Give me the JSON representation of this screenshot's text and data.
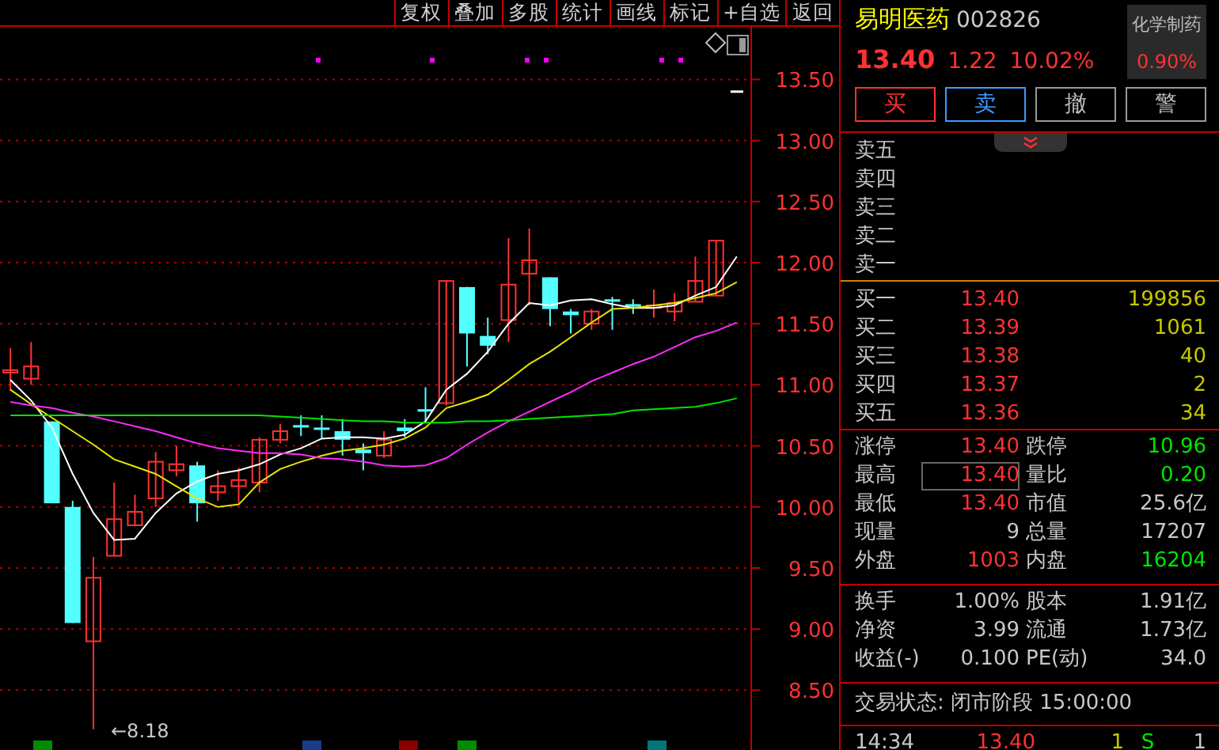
{
  "toolbar": [
    {
      "label": "复权"
    },
    {
      "label": "叠加"
    },
    {
      "label": "多股"
    },
    {
      "label": "统计"
    },
    {
      "label": "画线"
    },
    {
      "label": "标记"
    },
    {
      "label": "+自选"
    },
    {
      "label": "返回"
    }
  ],
  "chart": {
    "low_marker": "←8.18",
    "chart_data": {
      "type": "candlestick",
      "grid": true,
      "ylim": [
        8.01,
        13.93
      ],
      "yticks": [
        {
          "value": 13.5,
          "label": "13.50"
        },
        {
          "value": 13,
          "label": "13.00"
        },
        {
          "value": 12.5,
          "label": "12.50"
        },
        {
          "value": 12,
          "label": "12.00"
        },
        {
          "value": 11.5,
          "label": "11.50"
        },
        {
          "value": 11,
          "label": "11.00"
        },
        {
          "value": 10.5,
          "label": "10.50"
        },
        {
          "value": 10,
          "label": "10.00"
        },
        {
          "value": 9.5,
          "label": "9.50"
        },
        {
          "value": 9,
          "label": "9.00"
        },
        {
          "value": 8.5,
          "label": "8.50"
        }
      ],
      "categories": [
        null,
        null,
        null,
        null,
        null,
        null,
        null,
        null,
        null,
        null,
        null,
        null,
        null,
        null,
        null,
        null,
        null,
        null,
        null,
        null,
        null,
        null,
        null,
        null,
        null,
        null,
        null,
        null,
        null,
        null,
        null,
        null,
        null,
        null,
        null,
        null
      ],
      "ohlc": [
        [
          11.1,
          11.3,
          10.95,
          11.12
        ],
        [
          11.05,
          11.35,
          11.0,
          11.15
        ],
        [
          10.7,
          10.7,
          10.03,
          10.03
        ],
        [
          10.0,
          10.05,
          9.05,
          9.05
        ],
        [
          8.9,
          9.59,
          8.18,
          9.42
        ],
        [
          9.6,
          10.2,
          9.6,
          9.9
        ],
        [
          9.85,
          10.1,
          9.85,
          9.96
        ],
        [
          10.07,
          10.45,
          10.0,
          10.37
        ],
        [
          10.3,
          10.5,
          10.25,
          10.35
        ],
        [
          10.34,
          10.37,
          9.88,
          10.03
        ],
        [
          10.12,
          10.3,
          10.05,
          10.17
        ],
        [
          10.17,
          10.32,
          10.03,
          10.22
        ],
        [
          10.2,
          10.57,
          10.12,
          10.55
        ],
        [
          10.55,
          10.68,
          10.52,
          10.62
        ],
        [
          10.67,
          10.75,
          10.58,
          10.65
        ],
        [
          10.65,
          10.75,
          10.56,
          10.64
        ],
        [
          10.62,
          10.72,
          10.42,
          10.55
        ],
        [
          10.47,
          10.52,
          10.3,
          10.44
        ],
        [
          10.42,
          10.62,
          10.4,
          10.55
        ],
        [
          10.65,
          10.72,
          10.57,
          10.62
        ],
        [
          10.8,
          10.98,
          10.7,
          10.78
        ],
        [
          10.85,
          11.85,
          10.83,
          11.85
        ],
        [
          11.8,
          11.8,
          11.15,
          11.42
        ],
        [
          11.4,
          11.55,
          11.25,
          11.32
        ],
        [
          11.53,
          12.2,
          11.35,
          11.82
        ],
        [
          11.91,
          12.28,
          11.65,
          12.02
        ],
        [
          11.88,
          11.88,
          11.48,
          11.62
        ],
        [
          11.6,
          11.62,
          11.42,
          11.57
        ],
        [
          11.5,
          11.62,
          11.45,
          11.6
        ],
        [
          11.7,
          11.72,
          11.45,
          11.68
        ],
        [
          11.66,
          11.7,
          11.58,
          11.64
        ],
        [
          11.63,
          11.78,
          11.55,
          11.65
        ],
        [
          11.6,
          11.75,
          11.52,
          11.67
        ],
        [
          11.68,
          12.05,
          11.68,
          11.85
        ],
        [
          11.73,
          12.18,
          11.73,
          12.18
        ],
        [
          13.4,
          13.4,
          13.4,
          13.4
        ]
      ],
      "series": [
        {
          "type": "line",
          "color": "#ffffff",
          "values": [
            11.04,
            10.87,
            10.65,
            10.27,
            9.95,
            9.73,
            9.74,
            9.95,
            10.11,
            10.21,
            10.27,
            10.3,
            10.35,
            10.43,
            10.48,
            10.56,
            10.57,
            10.57,
            10.56,
            10.59,
            10.7,
            10.96,
            11.09,
            11.27,
            11.5,
            11.67,
            11.65,
            11.69,
            11.7,
            11.66,
            11.63,
            11.63,
            11.65,
            11.73,
            11.8,
            12.05
          ]
        },
        {
          "type": "line",
          "color": "#e6e600",
          "values": [
            10.96,
            10.84,
            10.73,
            10.62,
            10.51,
            10.39,
            10.33,
            10.27,
            10.17,
            10.07,
            10.0,
            10.02,
            10.2,
            10.31,
            10.37,
            10.42,
            10.46,
            10.48,
            10.51,
            10.56,
            10.65,
            10.81,
            10.86,
            10.92,
            11.04,
            11.17,
            11.27,
            11.39,
            11.51,
            11.62,
            11.63,
            11.65,
            11.67,
            11.71,
            11.75,
            11.84
          ]
        },
        {
          "type": "line",
          "color": "#ff2bff",
          "values": [
            10.86,
            10.83,
            10.81,
            10.77,
            10.74,
            10.7,
            10.66,
            10.62,
            10.57,
            10.52,
            10.48,
            10.46,
            10.44,
            10.44,
            10.43,
            10.4,
            10.39,
            10.37,
            10.34,
            10.33,
            10.34,
            10.4,
            10.51,
            10.61,
            10.7,
            10.78,
            10.86,
            10.94,
            11.03,
            11.1,
            11.17,
            11.23,
            11.31,
            11.39,
            11.44,
            11.51
          ]
        },
        {
          "type": "line",
          "color": "#00e600",
          "values": [
            10.75,
            10.75,
            10.75,
            10.75,
            10.75,
            10.75,
            10.75,
            10.75,
            10.75,
            10.75,
            10.75,
            10.75,
            10.75,
            10.74,
            10.73,
            10.72,
            10.71,
            10.7,
            10.7,
            10.69,
            10.69,
            10.69,
            10.7,
            10.7,
            10.71,
            10.72,
            10.73,
            10.74,
            10.75,
            10.76,
            10.79,
            10.8,
            10.81,
            10.82,
            10.85,
            10.89
          ]
        }
      ]
    }
  },
  "quote": {
    "name": "易明医药",
    "code": "002826",
    "price": "13.40",
    "change": "1.22",
    "change_pct": "10.02%",
    "sector": {
      "name": "化学制药",
      "change": "0.90%"
    }
  },
  "trade_buttons": [
    {
      "label": "买",
      "kind": "buy"
    },
    {
      "label": "卖",
      "kind": "sell"
    },
    {
      "label": "撤",
      "kind": "cancel"
    },
    {
      "label": "警",
      "kind": "alert"
    }
  ],
  "asks": [
    {
      "label": "卖五"
    },
    {
      "label": "卖四"
    },
    {
      "label": "卖三"
    },
    {
      "label": "卖二"
    },
    {
      "label": "卖一"
    }
  ],
  "bids": [
    {
      "label": "买一",
      "price": "13.40",
      "volume": "199856"
    },
    {
      "label": "买二",
      "price": "13.39",
      "volume": "1061"
    },
    {
      "label": "买三",
      "price": "13.38",
      "volume": "40"
    },
    {
      "label": "买四",
      "price": "13.37",
      "volume": "2"
    },
    {
      "label": "买五",
      "price": "13.36",
      "volume": "34"
    }
  ],
  "stats": [
    [
      {
        "label": "涨停",
        "value": "13.40",
        "color": "#ff3232",
        "highlighted": false
      },
      {
        "label": "跌停",
        "value": "10.96",
        "color": "#00e600",
        "highlighted": false
      }
    ],
    [
      {
        "label": "最高",
        "value": "13.40",
        "color": "#ff3232",
        "highlighted": true
      },
      {
        "label": "量比",
        "value": "0.20",
        "color": "#00e600",
        "highlighted": false
      }
    ],
    [
      {
        "label": "最低",
        "value": "13.40",
        "color": "#ff3232",
        "highlighted": false
      },
      {
        "label": "市值",
        "value": "25.6亿",
        "color": "#c8c8c8",
        "highlighted": false
      }
    ],
    [
      {
        "label": "现量",
        "value": "9",
        "color": "#c8c8c8",
        "highlighted": false
      },
      {
        "label": "总量",
        "value": "17207",
        "color": "#c8c8c8",
        "highlighted": false
      }
    ],
    [
      {
        "label": "外盘",
        "value": "1003",
        "color": "#ff3232",
        "highlighted": false
      },
      {
        "label": "内盘",
        "value": "16204",
        "color": "#00e600",
        "highlighted": false
      }
    ]
  ],
  "finance": [
    [
      {
        "label": "换手",
        "value": "1.00%"
      },
      {
        "label": "股本",
        "value": "1.91亿"
      }
    ],
    [
      {
        "label": "净资",
        "value": "3.99"
      },
      {
        "label": "流通",
        "value": "1.73亿"
      }
    ],
    [
      {
        "label": "收益(-)",
        "value": "0.100"
      },
      {
        "label": "PE(动)",
        "value": "34.0"
      }
    ]
  ],
  "trade_status": "交易状态: 闭市阶段 15:00:00",
  "ticks": [
    {
      "time": "14:34",
      "price": "13.40",
      "volume": "1",
      "side": "S",
      "count": "1"
    }
  ]
}
